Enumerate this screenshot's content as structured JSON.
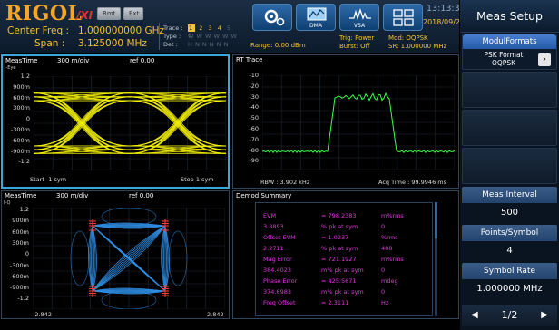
{
  "header": {
    "logo": "RIGOL",
    "logo_suffix": "/XI",
    "btn_rmt": "Rmt",
    "btn_ext": "Ext",
    "center_freq_label": "Center Freq :",
    "center_freq_value": "1.000000000 GHz",
    "span_label": "Span :",
    "span_value": "3.125000 MHz",
    "trace_label": "Trace :",
    "type_label": "Type :",
    "det_label": "Det :",
    "trace_nums": [
      "1",
      "2",
      "3",
      "4",
      "5",
      "6"
    ],
    "type_row": "W W W W W W",
    "det_row": "H N N N N N",
    "icons": [
      {
        "name": "gear-icon",
        "label": ""
      },
      {
        "name": "dma-icon",
        "label": "DMA"
      },
      {
        "name": "vsa-icon",
        "label": "VSA"
      },
      {
        "name": "layout-icon",
        "label": ""
      }
    ],
    "time": "13:13:33",
    "date": "2018/09/28",
    "range": "Range: 0.00 dBm",
    "trig": "Trig: Power",
    "burst": "Burst: Off",
    "mod": "Mod: OQPSK",
    "sr": "SR: 1.000000 MHz"
  },
  "side": {
    "title": "Meas Setup",
    "modformats_title": "ModulFormats",
    "psk_label": "PSK Format OQPSK",
    "meas_interval_label": "Meas Interval",
    "meas_interval_value": "500",
    "points_label": "Points/Symbol",
    "points_value": "4",
    "symbol_rate_label": "Symbol Rate",
    "symbol_rate_value": "1.000000 MHz",
    "page": "1/2"
  },
  "eye": {
    "title": "MeasTime",
    "scale": "300 m/div",
    "ref": "ref 0.00",
    "unit": "I-Eye",
    "y_ticks": [
      "1.2",
      "900m",
      "600m",
      "300m",
      "0",
      "-300m",
      "-600m",
      "-900m",
      "-1.2"
    ],
    "start": "Start -1 sym",
    "stop": "Stop 1 sym"
  },
  "rt": {
    "title": "RT Trace",
    "y_ticks": [
      "-10",
      "-20",
      "-30",
      "-40",
      "-50",
      "-60",
      "-70",
      "-80",
      "-90"
    ],
    "rbw": "RBW : 3.902 kHz",
    "acq": "Acq Time : 99.9946 ms"
  },
  "const": {
    "title": "MeasTime",
    "scale": "300 m/div",
    "ref": "ref 0.00",
    "unit": "I-Q",
    "y_ticks": [
      "1.2",
      "900m",
      "600m",
      "300m",
      "0",
      "-300m",
      "-600m",
      "-900m",
      "-1.2"
    ],
    "x_min": "-2.842",
    "x_max": "2.842"
  },
  "demod": {
    "title": "Demod Summary",
    "rows": [
      {
        "name": "EVM",
        "value": "= 798.2383",
        "unit": "m%rms"
      },
      {
        "name": "3.8893",
        "value": "% pk  at  sym",
        "unit": "0"
      },
      {
        "name": "Offset EVM",
        "value": "= 1.0237",
        "unit": "%rms"
      },
      {
        "name": "2.2711",
        "value": "% pk  at  sym",
        "unit": "488"
      },
      {
        "name": "Mag Error",
        "value": "= 721.1927",
        "unit": "m%rms"
      },
      {
        "name": "384.4023",
        "value": "m% pk  at  sym",
        "unit": "0"
      },
      {
        "name": "Phase Error",
        "value": "= 425.5671",
        "unit": "mdeg"
      },
      {
        "name": "374.6983",
        "value": "m% pk  at  sym",
        "unit": "0"
      },
      {
        "name": "Freq Offset",
        "value": "= 2.3111",
        "unit": "Hz"
      }
    ]
  },
  "colors": {
    "eye_trace": "#f3f000",
    "spectrum_trace": "#39ff4a",
    "const_trace": "#2f8fe6",
    "const_points": "#ff3a3a",
    "accent": "#f2c232",
    "demod_text": "#e135e1"
  }
}
